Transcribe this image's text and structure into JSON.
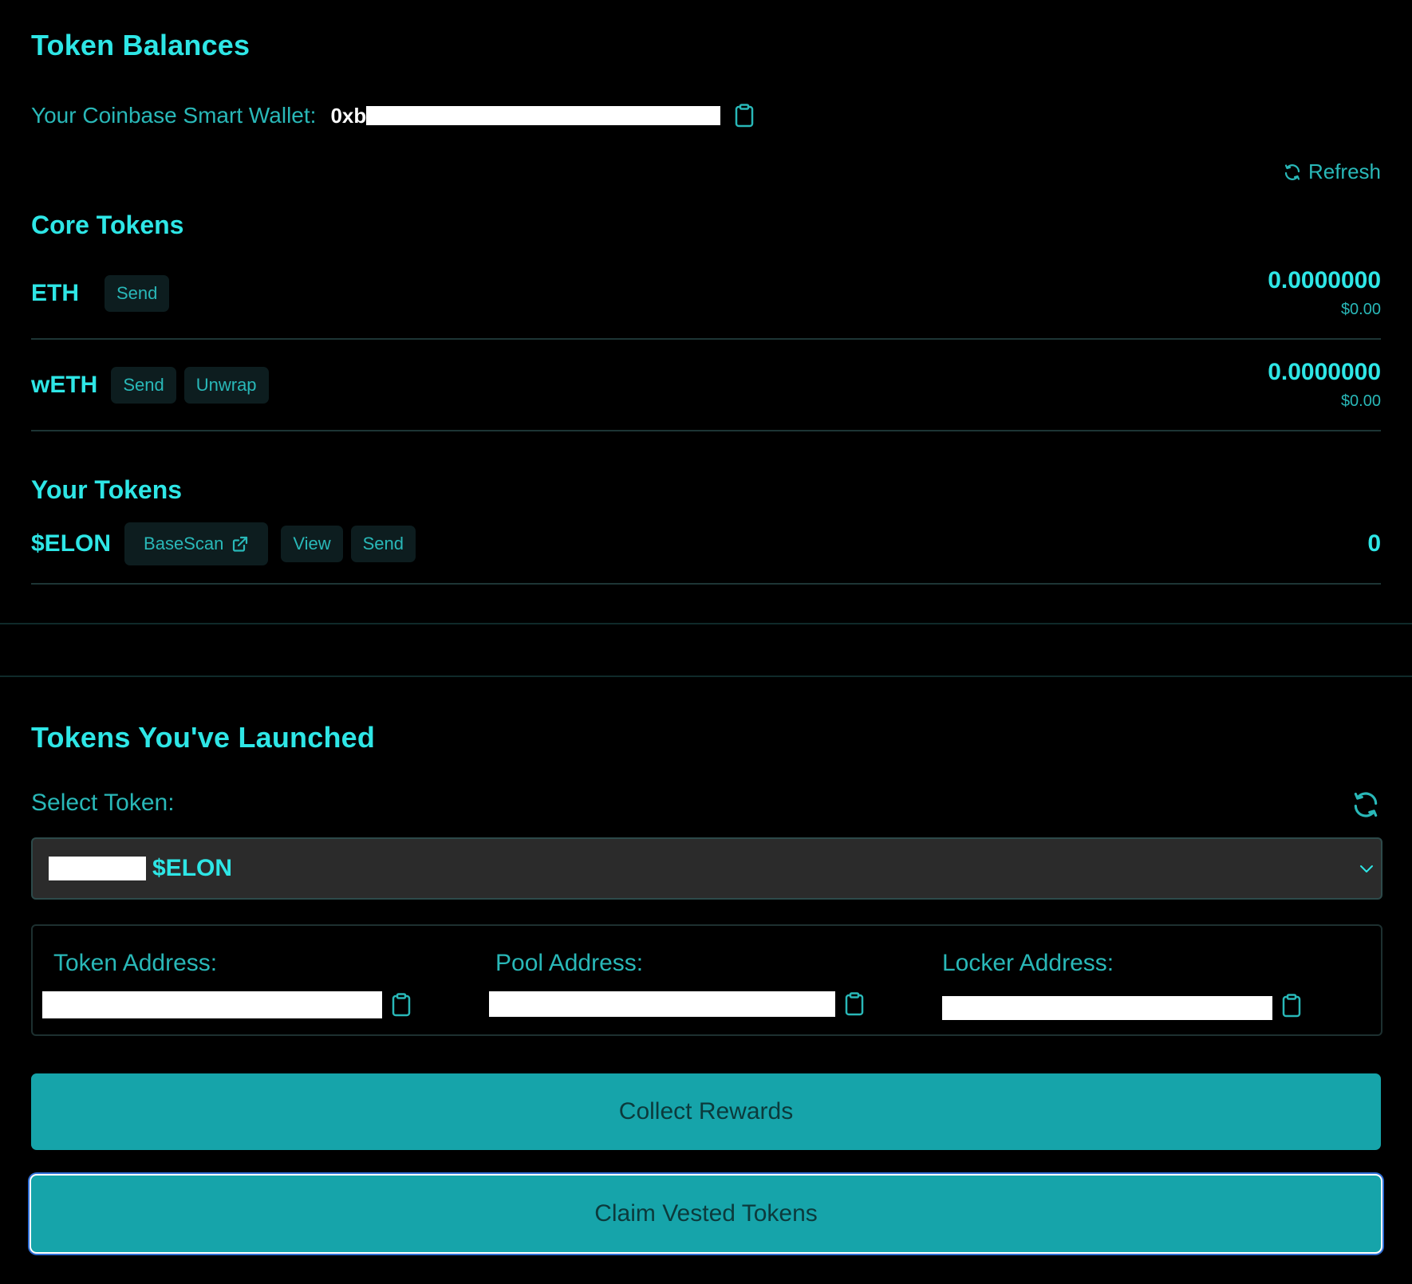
{
  "balances": {
    "title": "Token Balances",
    "wallet_label": "Your Coinbase Smart Wallet:",
    "wallet_prefix": "0xb",
    "refresh_label": "Refresh"
  },
  "core": {
    "title": "Core Tokens",
    "rows": [
      {
        "symbol": "ETH",
        "actions": [
          "Send"
        ],
        "amount": "0.0000000",
        "usd": "$0.00"
      },
      {
        "symbol": "wETH",
        "actions": [
          "Send",
          "Unwrap"
        ],
        "amount": "0.0000000",
        "usd": "$0.00"
      }
    ]
  },
  "yours": {
    "title": "Your Tokens",
    "row": {
      "symbol": "$ELON",
      "basescan": "BaseScan",
      "view": "View",
      "send": "Send",
      "amount": "0"
    }
  },
  "launched": {
    "title": "Tokens You've Launched",
    "select_label": "Select Token:",
    "selected_token": "$ELON",
    "token_address_label": "Token Address:",
    "pool_address_label": "Pool Address:",
    "locker_address_label": "Locker Address:",
    "collect_button": "Collect Rewards",
    "claim_button": "Claim Vested Tokens"
  },
  "icons": {
    "clipboard": "clipboard-icon",
    "refresh": "refresh-icon",
    "external_link": "external-link-icon",
    "chevron": "chevron-down-icon"
  },
  "colors": {
    "accent": "#2ee6e6",
    "muted": "#29b8b8",
    "button": "#16a4aa",
    "background": "#000000"
  }
}
